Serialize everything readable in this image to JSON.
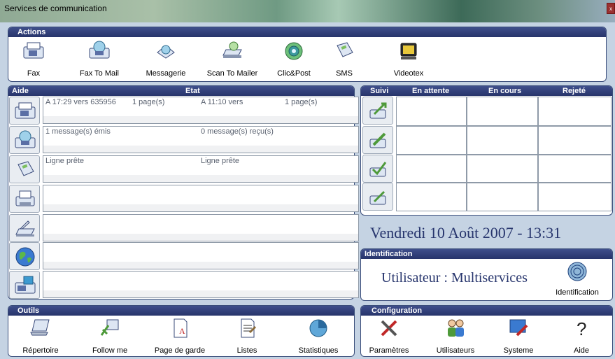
{
  "window": {
    "title": "Services de communication",
    "close_label": "x"
  },
  "actions": {
    "header": "Actions",
    "items": [
      {
        "label": "Fax",
        "icon": "fax-icon"
      },
      {
        "label": "Fax To Mail",
        "icon": "fax-to-mail-icon"
      },
      {
        "label": "Messagerie",
        "icon": "mail-icon"
      },
      {
        "label": "Scan To Mailer",
        "icon": "scan-to-mailer-icon"
      },
      {
        "label": "Clic&Post",
        "icon": "clic-post-icon"
      },
      {
        "label": "SMS",
        "icon": "sms-icon"
      },
      {
        "label": "Videotex",
        "icon": "videotex-icon"
      }
    ]
  },
  "status_panel": {
    "help_label": "Aide",
    "state_label": "Etat",
    "rows": [
      {
        "icon": "fax-icon",
        "c1": "A 17:29 vers 635956",
        "c2": "1 page(s)",
        "c3": "A 11:10 vers",
        "c4": "1 page(s)"
      },
      {
        "icon": "fax-to-mail-icon",
        "c1": "1 message(s) émis",
        "c2": "",
        "c3": "0 message(s) reçu(s)",
        "c4": ""
      },
      {
        "icon": "sms-icon",
        "c1": "Ligne prête",
        "c2": "",
        "c3": "Ligne prête",
        "c4": ""
      },
      {
        "icon": "printer-icon",
        "c1": "",
        "c2": "",
        "c3": "",
        "c4": ""
      },
      {
        "icon": "scanner-icon",
        "c1": "",
        "c2": "",
        "c3": "",
        "c4": ""
      },
      {
        "icon": "globe-icon",
        "c1": "",
        "c2": "",
        "c3": "",
        "c4": ""
      },
      {
        "icon": "fax-machine-icon",
        "c1": "",
        "c2": "",
        "c3": "",
        "c4": ""
      }
    ]
  },
  "tracking": {
    "headers": {
      "suivi": "Suivi",
      "pending": "En attente",
      "in_progress": "En cours",
      "rejected": "Rejeté"
    }
  },
  "datetime": "Vendredi 10 Août 2007 - 13:31",
  "identification": {
    "header": "Identification",
    "user_text": "Utilisateur : Multiservices",
    "button_label": "Identification"
  },
  "tools": {
    "header": "Outils",
    "items": [
      {
        "label": "Répertoire",
        "icon": "laptop-icon"
      },
      {
        "label": "Follow me",
        "icon": "follow-me-icon"
      },
      {
        "label": "Page de garde",
        "icon": "cover-page-icon"
      },
      {
        "label": "Listes",
        "icon": "list-icon"
      },
      {
        "label": "Statistiques",
        "icon": "pie-chart-icon"
      }
    ]
  },
  "configuration": {
    "header": "Configuration",
    "items": [
      {
        "label": "Paramètres",
        "icon": "tools-icon"
      },
      {
        "label": "Utilisateurs",
        "icon": "users-icon"
      },
      {
        "label": "Systeme",
        "icon": "system-icon"
      },
      {
        "label": "Aide",
        "icon": "help-icon"
      }
    ]
  },
  "colors": {
    "header_bg": "#2f3d78",
    "title_text": "#27356d",
    "accent_green": "#4e9a3a"
  }
}
